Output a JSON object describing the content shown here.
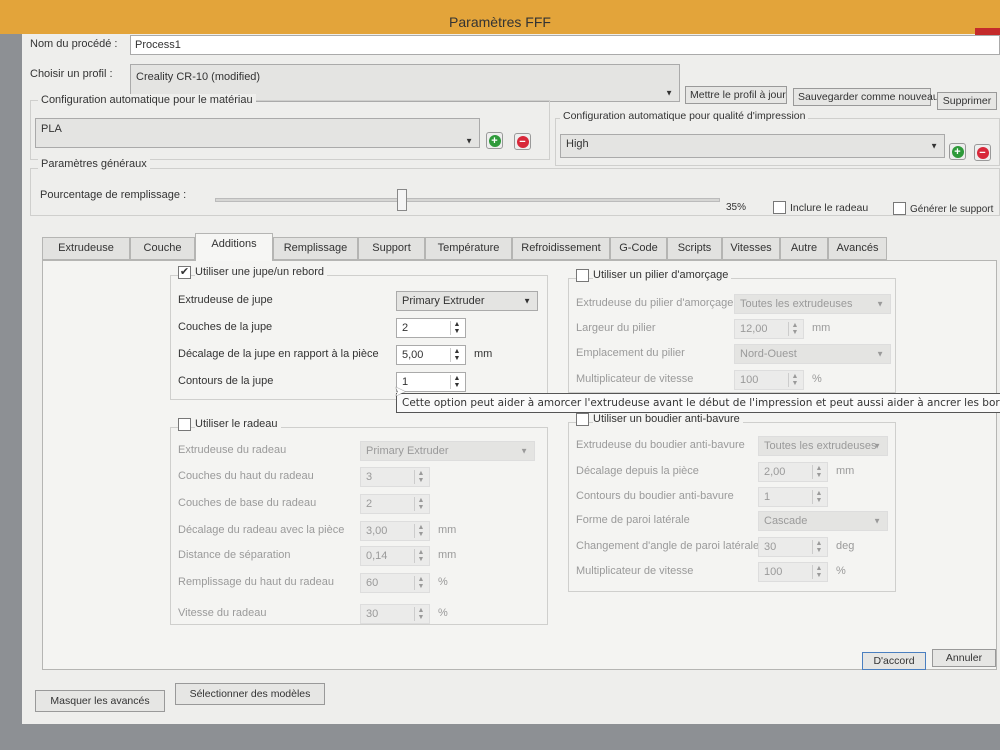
{
  "window": {
    "title": "Paramètres FFF",
    "help": "?",
    "close": "x"
  },
  "process": {
    "label": "Nom du procédé :",
    "value": "Process1"
  },
  "profile": {
    "label": "Choisir un profil :",
    "value": "Creality CR-10 (modified)",
    "update": "Mettre le profil à jour",
    "save_new": "Sauvegarder comme nouveau",
    "delete": "Supprimer"
  },
  "material": {
    "label": "Configuration automatique pour le matériau",
    "value": "PLA"
  },
  "quality": {
    "label": "Configuration automatique pour qualité d'impression",
    "value": "High"
  },
  "general": {
    "label": "Paramètres généraux",
    "infill_label": "Pourcentage de remplissage :",
    "infill_value": "35%",
    "infill_percent": 35,
    "raft_label": "Inclure le radeau",
    "raft_checked": false,
    "support_label": "Générer le support",
    "support_checked": false
  },
  "tabs": [
    {
      "label": "Extrudeuse"
    },
    {
      "label": "Couche"
    },
    {
      "label": "Additions",
      "active": true
    },
    {
      "label": "Remplissage"
    },
    {
      "label": "Support"
    },
    {
      "label": "Température"
    },
    {
      "label": "Refroidissement"
    },
    {
      "label": "G-Code"
    },
    {
      "label": "Scripts"
    },
    {
      "label": "Vitesses"
    },
    {
      "label": "Autre"
    },
    {
      "label": "Avancés"
    }
  ],
  "skirt": {
    "title": "Utiliser une jupe/un rebord",
    "checked": true,
    "rows": [
      {
        "label": "Extrudeuse de jupe",
        "value": "Primary Extruder",
        "type": "combo"
      },
      {
        "label": "Couches de la jupe",
        "value": "2",
        "type": "spin"
      },
      {
        "label": "Décalage de la jupe en rapport à la pièce",
        "value": "5,00",
        "type": "spin",
        "unit": "mm"
      },
      {
        "label": "Contours de la jupe",
        "value": "1",
        "type": "spin"
      }
    ]
  },
  "raft": {
    "title": "Utiliser le radeau",
    "checked": false,
    "rows": [
      {
        "label": "Extrudeuse du radeau",
        "value": "Primary Extruder",
        "type": "combo"
      },
      {
        "label": "Couches du haut du radeau",
        "value": "3",
        "type": "spin"
      },
      {
        "label": "Couches de base du radeau",
        "value": "2",
        "type": "spin"
      },
      {
        "label": "Décalage du radeau avec la pièce",
        "value": "3,00",
        "type": "spin",
        "unit": "mm"
      },
      {
        "label": "Distance de séparation",
        "value": "0,14",
        "type": "spin",
        "unit": "mm"
      },
      {
        "label": "Remplissage du haut du radeau",
        "value": "60",
        "type": "spin",
        "unit": "%"
      },
      {
        "label": "Vitesse du radeau",
        "value": "30",
        "type": "spin",
        "unit": "%"
      }
    ]
  },
  "pillar": {
    "title": "Utiliser un pilier d'amorçage",
    "checked": false,
    "rows": [
      {
        "label": "Extrudeuse du pilier d'amorçage",
        "value": "Toutes les extrudeuses",
        "type": "combo"
      },
      {
        "label": "Largeur du pilier",
        "value": "12,00",
        "type": "spin",
        "unit": "mm"
      },
      {
        "label": "Emplacement du pilier",
        "value": "Nord-Ouest",
        "type": "combo"
      },
      {
        "label": "Multiplicateur de vitesse",
        "value": "100",
        "type": "spin",
        "unit": "%"
      }
    ]
  },
  "shield": {
    "title": "Utiliser un boudier anti-bavure",
    "checked": false,
    "rows": [
      {
        "label": "Extrudeuse du boudier anti-bavure",
        "value": "Toutes les extrudeuses",
        "type": "combo"
      },
      {
        "label": "Décalage depuis la pièce",
        "value": "2,00",
        "type": "spin",
        "unit": "mm"
      },
      {
        "label": "Contours du boudier anti-bavure",
        "value": "1",
        "type": "spin"
      },
      {
        "label": "Forme de paroi latérale",
        "value": "Cascade",
        "type": "combo"
      },
      {
        "label": "Changement d'angle de paroi latérale",
        "value": "30",
        "type": "spin",
        "unit": "deg"
      },
      {
        "label": "Multiplicateur de vitesse",
        "value": "100",
        "type": "spin",
        "unit": "%"
      }
    ]
  },
  "tooltip": "Cette option peut aider à amorcer l'extrudeuse avant le début de l'impression et peut aussi aider à ancrer les bords du m",
  "footer": {
    "ok": "D'accord",
    "cancel": "Annuler",
    "hide_advanced": "Masquer les avancés",
    "select_models": "Sélectionner des modèles"
  },
  "colors": {
    "titlebar": "#e3a43a",
    "close": "#c42b2b",
    "add": "#2e9a3a",
    "remove": "#d8283a"
  }
}
